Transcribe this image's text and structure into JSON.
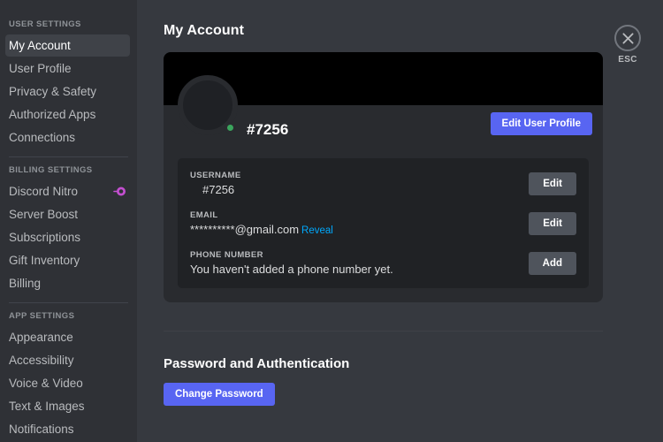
{
  "sidebar": {
    "sections": [
      {
        "header": "USER SETTINGS",
        "items": [
          {
            "label": "My Account",
            "active": true
          },
          {
            "label": "User Profile",
            "active": false
          },
          {
            "label": "Privacy & Safety",
            "active": false
          },
          {
            "label": "Authorized Apps",
            "active": false
          },
          {
            "label": "Connections",
            "active": false
          }
        ]
      },
      {
        "header": "BILLING SETTINGS",
        "items": [
          {
            "label": "Discord Nitro",
            "active": false,
            "icon": "nitro-wheel-icon"
          },
          {
            "label": "Server Boost",
            "active": false
          },
          {
            "label": "Subscriptions",
            "active": false
          },
          {
            "label": "Gift Inventory",
            "active": false
          },
          {
            "label": "Billing",
            "active": false
          }
        ]
      },
      {
        "header": "APP SETTINGS",
        "items": [
          {
            "label": "Appearance",
            "active": false
          },
          {
            "label": "Accessibility",
            "active": false
          },
          {
            "label": "Voice & Video",
            "active": false
          },
          {
            "label": "Text & Images",
            "active": false
          },
          {
            "label": "Notifications",
            "active": false
          }
        ]
      }
    ]
  },
  "main": {
    "title": "My Account",
    "account_card": {
      "display_name": "#7256",
      "status": "online",
      "edit_profile_label": "Edit User Profile",
      "fields": [
        {
          "label": "USERNAME",
          "value": "#7256",
          "action_label": "Edit",
          "indent": true
        },
        {
          "label": "EMAIL",
          "value": "**********@gmail.com",
          "reveal_label": "Reveal",
          "action_label": "Edit",
          "indent": false
        },
        {
          "label": "PHONE NUMBER",
          "value": "You haven't added a phone number yet.",
          "action_label": "Add",
          "indent": false
        }
      ]
    },
    "password_section": {
      "title": "Password and Authentication",
      "change_password_label": "Change Password"
    }
  },
  "close": {
    "icon": "close-x-icon",
    "label": "ESC"
  },
  "colors": {
    "accent_blurple": "#5865f2",
    "link_blue": "#00a8fc",
    "online_green": "#3ba55d",
    "nitro_pink": "#c44fd1",
    "sidebar_bg": "#2f3136",
    "content_bg": "#36393f",
    "card_bg": "#292b2f",
    "panel_bg": "#202225"
  }
}
